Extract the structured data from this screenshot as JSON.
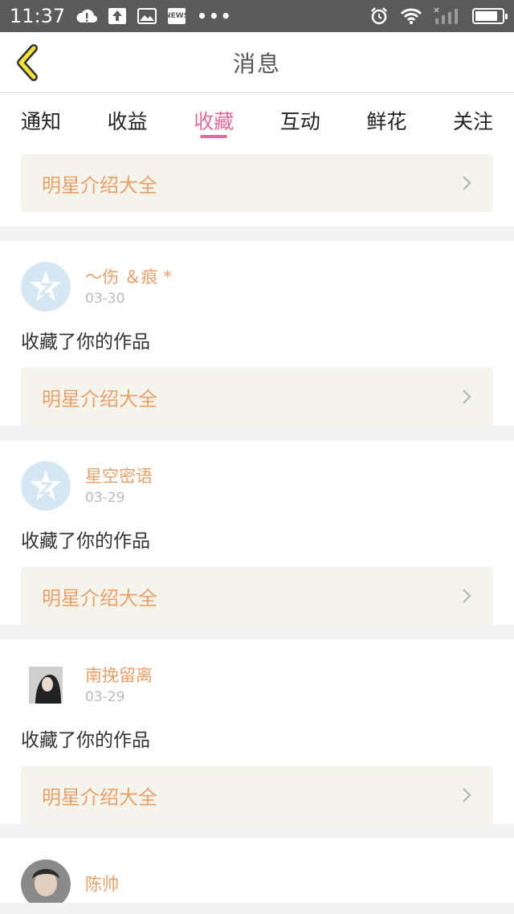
{
  "status_bar": {
    "time": "11:37",
    "news_label": "NEWS",
    "battery_level": 0.85
  },
  "header": {
    "title": "消息"
  },
  "tabs": [
    {
      "label": "通知",
      "active": false
    },
    {
      "label": "收益",
      "active": false
    },
    {
      "label": "收藏",
      "active": true
    },
    {
      "label": "互动",
      "active": false
    },
    {
      "label": "鲜花",
      "active": false
    },
    {
      "label": "关注",
      "active": false
    }
  ],
  "first_card": {
    "work_title": "明星介绍大全"
  },
  "notifications": [
    {
      "user_name": "～伤 ＆痕 *",
      "date": "03-30",
      "action": "收藏了你的作品",
      "work_title": "明星介绍大全",
      "avatar": "default-avatar"
    },
    {
      "user_name": "星空密语",
      "date": "03-29",
      "action": "收藏了你的作品",
      "work_title": "明星介绍大全",
      "avatar": "default-avatar"
    },
    {
      "user_name": "南挽留离",
      "date": "03-29",
      "action": "收藏了你的作品",
      "work_title": "明星介绍大全",
      "avatar": "photo-avatar"
    },
    {
      "user_name": "陈帅",
      "date": "",
      "action": "",
      "work_title": "",
      "avatar": "photo-avatar"
    }
  ],
  "colors": {
    "accent": "#e26c9b",
    "name": "#e8a06a",
    "status_bar": "#5b5b5b",
    "work_box_bg": "#f4f4ec"
  }
}
